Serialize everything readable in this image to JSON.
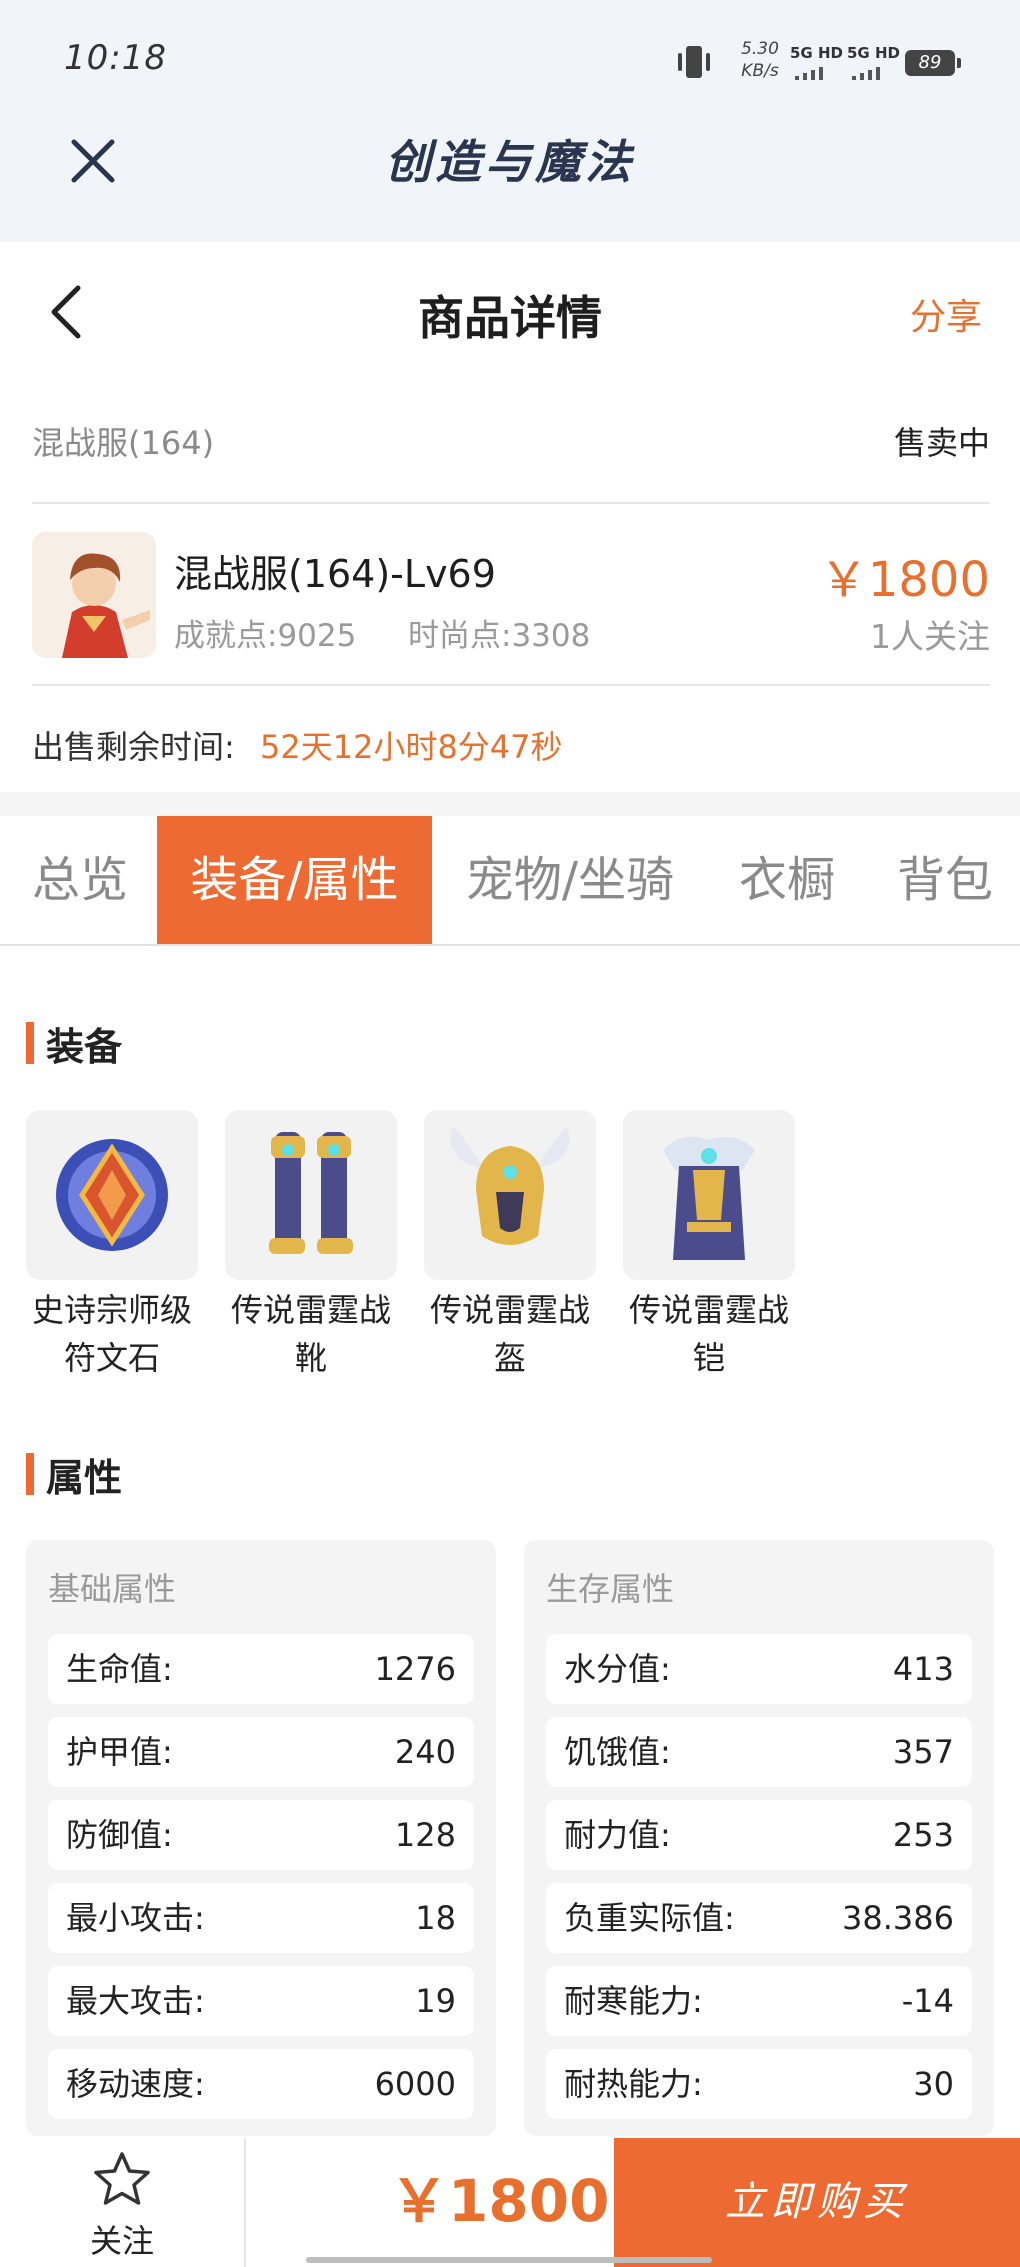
{
  "status_bar": {
    "time": "10:18",
    "speed_value": "5.30",
    "speed_unit": "KB/s",
    "network1": "5G HD",
    "network2": "5G HD",
    "battery": "89"
  },
  "app": {
    "title": "创造与魔法"
  },
  "nav": {
    "title": "商品详情",
    "share_label": "分享"
  },
  "listing": {
    "name": "混战服(164)",
    "status": "售卖中",
    "item_title": "混战服(164)-Lv69",
    "achievement": "成就点:9025",
    "fashion": "时尚点:3308",
    "price": "￥1800",
    "followers": "1人关注",
    "remaining_label": "出售剩余时间:",
    "remaining_value": "52天12小时8分47秒"
  },
  "tabs": [
    {
      "label": "总览"
    },
    {
      "label": "装备/属性",
      "active": true
    },
    {
      "label": "宠物/坐骑"
    },
    {
      "label": "衣橱"
    },
    {
      "label": "背包"
    }
  ],
  "equipment": {
    "heading": "装备",
    "items": [
      {
        "name": "史诗宗师级符文石",
        "icon": "rune-stone-icon"
      },
      {
        "name": "传说雷霆战靴",
        "icon": "boots-icon"
      },
      {
        "name": "传说雷霆战盔",
        "icon": "helmet-icon"
      },
      {
        "name": "传说雷霆战铠",
        "icon": "armor-icon"
      }
    ]
  },
  "attributes": {
    "heading": "属性",
    "basic": {
      "title": "基础属性",
      "rows": [
        {
          "key": "生命值:",
          "value": "1276"
        },
        {
          "key": "护甲值:",
          "value": "240"
        },
        {
          "key": "防御值:",
          "value": "128"
        },
        {
          "key": "最小攻击:",
          "value": "18"
        },
        {
          "key": "最大攻击:",
          "value": "19"
        },
        {
          "key": "移动速度:",
          "value": "6000"
        }
      ]
    },
    "survival": {
      "title": "生存属性",
      "rows": [
        {
          "key": "水分值:",
          "value": "413"
        },
        {
          "key": "饥饿值:",
          "value": "357"
        },
        {
          "key": "耐力值:",
          "value": "253"
        },
        {
          "key": "负重实际值:",
          "value": "38.386"
        },
        {
          "key": "耐寒能力:",
          "value": "-14"
        },
        {
          "key": "耐热能力:",
          "value": "30"
        }
      ]
    }
  },
  "bottom": {
    "follow_label": "关注",
    "price": "￥1800",
    "buy_label": "立即购买"
  },
  "colors": {
    "accent": "#ed6a32",
    "price": "#e8702f",
    "header_bg": "#f1f4f8"
  }
}
